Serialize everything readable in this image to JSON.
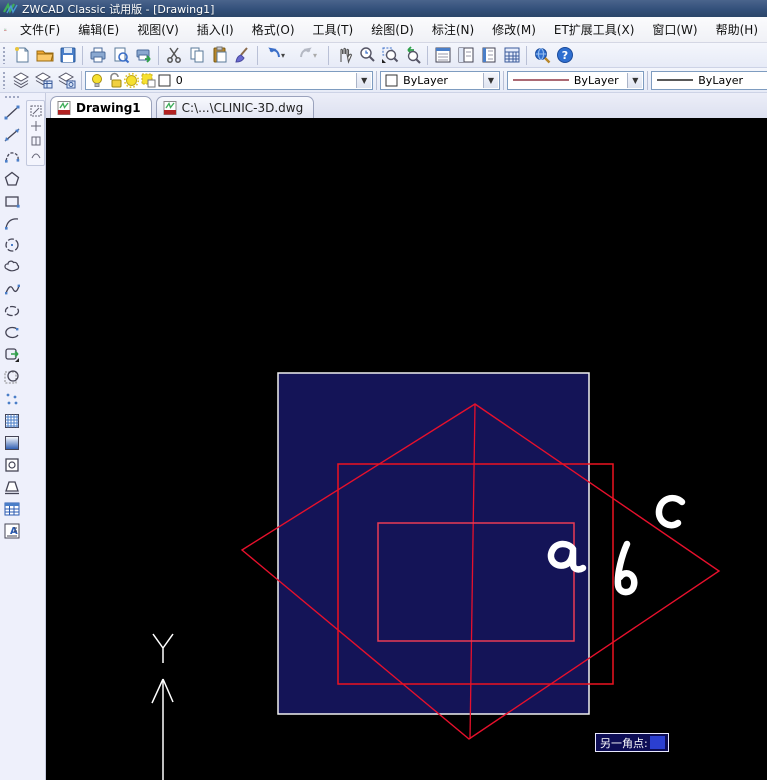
{
  "window": {
    "title": "ZWCAD Classic 试用版 - [Drawing1]"
  },
  "menubar": {
    "items": [
      "文件(F)",
      "编辑(E)",
      "视图(V)",
      "插入(I)",
      "格式(O)",
      "工具(T)",
      "绘图(D)",
      "标注(N)",
      "修改(M)",
      "ET扩展工具(X)",
      "窗口(W)",
      "帮助(H)"
    ]
  },
  "toolbar_standard": {
    "buttons": [
      "new",
      "open",
      "save",
      "print",
      "print-preview",
      "publish",
      "cut",
      "copy",
      "paste",
      "match-properties",
      "undo",
      "redo",
      "pan",
      "zoom-realtime",
      "zoom-window",
      "zoom-previous",
      "properties-palette",
      "design-center",
      "tool-palettes",
      "quick-calc",
      "find",
      "help"
    ]
  },
  "toolbar_layers": {
    "buttons": [
      "layer-properties",
      "layer-manager",
      "layer-states"
    ],
    "layer_combo": {
      "value": "0",
      "icons": [
        "bulb",
        "lock-open",
        "sun-on",
        "freeze",
        "color-swatch"
      ]
    },
    "color_combo": {
      "value": "ByLayer"
    },
    "linetype_combo": {
      "value": "ByLayer"
    },
    "lineweight_combo": {
      "value": "ByLayer"
    }
  },
  "tabs": [
    {
      "label": "Drawing1",
      "active": true
    },
    {
      "label": "C:\\...\\CLINIC-3D.dwg",
      "active": false
    }
  ],
  "draw_toolbar": {
    "tools": [
      "line",
      "construction-line",
      "polyline",
      "polygon",
      "rectangle",
      "arc",
      "circle",
      "revision-cloud",
      "spline",
      "ellipse",
      "ellipse-arc",
      "insert-block",
      "make-block",
      "point",
      "hatch",
      "gradient",
      "region",
      "wipeout",
      "table",
      "mtext"
    ]
  },
  "canvas": {
    "dynamic_input_label": "另一角点:",
    "annotations": {
      "a": "a",
      "b": "b",
      "c": "c"
    },
    "ucs_axis_label": "Y",
    "colors": {
      "background": "#000000",
      "square_fill": "#141457",
      "square_border": "#f0f0f0",
      "red_line": "#e6102c",
      "inner_rect": "#ea3b55",
      "annotation": "#ffffff",
      "tooltip_bg": "#0d0d55",
      "tooltip_highlight": "#2b3fd0"
    }
  }
}
